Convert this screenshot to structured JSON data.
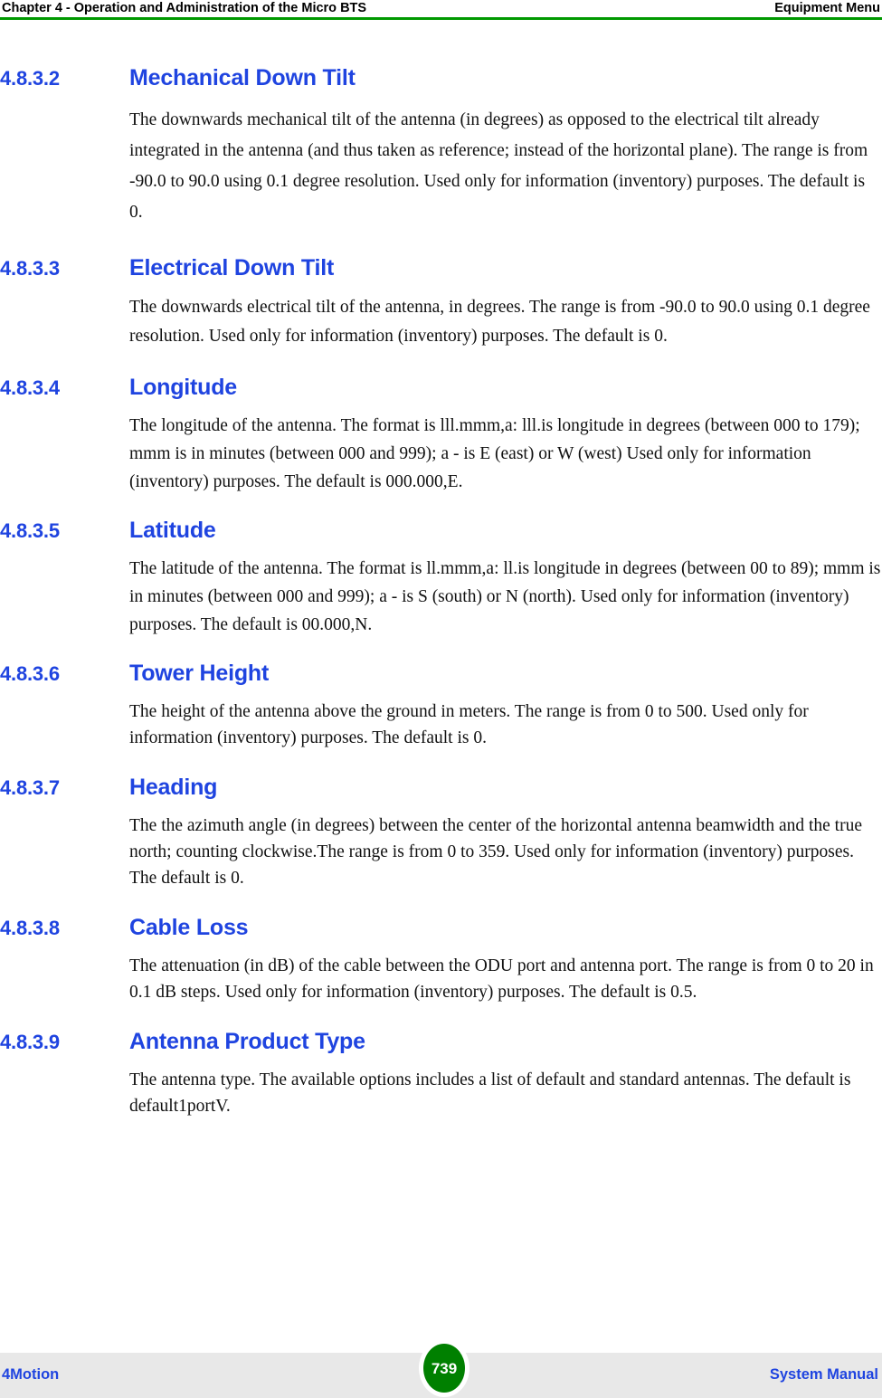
{
  "header": {
    "left": "Chapter 4 - Operation and Administration of the Micro BTS",
    "right": "Equipment Menu",
    "rule_color": "#009900"
  },
  "footer": {
    "left": "4Motion",
    "right": "System Manual",
    "page_number": "739",
    "band_color": "#E8E8E8",
    "badge_color": "#008000",
    "text_color": "#1F44E0"
  },
  "theme": {
    "heading_color": "#1F44E0",
    "body_color": "#111111"
  },
  "sections": [
    {
      "number": "4.8.3.2",
      "title": "Mechanical Down Tilt",
      "body": "The downwards mechanical tilt of the antenna (in degrees) as opposed to the electrical tilt already integrated in the antenna (and thus taken as reference; instead of the horizontal plane). The range is from -90.0 to 90.0 using 0.1 degree resolution. Used only for information (inventory) purposes. The default is 0."
    },
    {
      "number": "4.8.3.3",
      "title": "Electrical Down Tilt",
      "body": "The downwards electrical tilt of the antenna, in degrees. The range is from -90.0 to 90.0 using 0.1 degree resolution. Used only for information (inventory) purposes. The default is 0."
    },
    {
      "number": "4.8.3.4",
      "title": "Longitude",
      "body": "The longitude of the antenna. The format is lll.mmm,a: lll.is longitude in degrees (between 000 to 179); mmm is in minutes (between 000 and 999); a - is E (east) or W (west) Used only for information (inventory) purposes. The default is 000.000,E."
    },
    {
      "number": "4.8.3.5",
      "title": "Latitude",
      "body": "The latitude of the antenna. The format is ll.mmm,a: ll.is longitude in degrees (between 00 to 89); mmm is in minutes (between 000 and 999); a - is S (south) or N (north). Used only for information (inventory) purposes. The default is 00.000,N."
    },
    {
      "number": "4.8.3.6",
      "title": "Tower Height",
      "body": "The height of the antenna above the ground in meters. The range is from 0 to 500. Used only for information (inventory) purposes. The default is 0."
    },
    {
      "number": "4.8.3.7",
      "title": "Heading",
      "body": "The the azimuth angle (in degrees) between the center of the horizontal antenna beamwidth and the true north; counting clockwise.The range is from 0 to 359. Used only for information (inventory) purposes. The default is 0."
    },
    {
      "number": "4.8.3.8",
      "title": "Cable Loss",
      "body": "The attenuation (in dB) of the cable between the ODU port and antenna port. The range is from 0 to 20 in 0.1 dB steps. Used only for information (inventory) purposes. The default is 0.5."
    },
    {
      "number": "4.8.3.9",
      "title": "Antenna Product Type",
      "body": "The antenna type. The available options includes a list of default and standard antennas. The default is default1portV."
    }
  ]
}
